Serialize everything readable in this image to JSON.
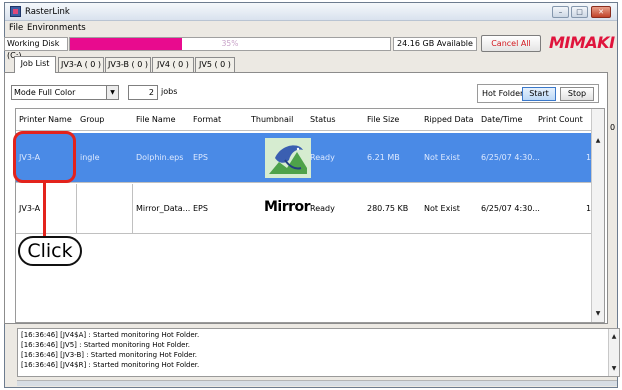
{
  "window": {
    "title": "RasterLink"
  },
  "menu": {
    "items": [
      "File",
      "Environments"
    ]
  },
  "disk": {
    "label": "Working Disk (C:)",
    "progress_percent": 35,
    "progress_text": "35%",
    "available": "24.16 GB Available",
    "cancel_label": "Cancel All"
  },
  "brand": {
    "logo_text": "MIMAKI",
    "color": "#e0143c"
  },
  "tabs": [
    "Job List",
    "JV3-A ( 0 )",
    "JV3-B ( 0 )",
    "JV4 ( 0 )",
    "JV5 ( 0 )"
  ],
  "toolbar": {
    "mode_value": "Mode Full Color",
    "jobs_count": "2",
    "jobs_label": "jobs",
    "hot_folder_label": "Hot Folder",
    "start_label": "Start",
    "stop_label": "Stop"
  },
  "table": {
    "columns": [
      "Printer Name",
      "Group",
      "File Name",
      "Format",
      "Thumbnail",
      "Status",
      "File Size",
      "Ripped Data",
      "Date/Time",
      "Print Count"
    ],
    "rows": [
      {
        "printer": "JV3-A",
        "group": "ingle",
        "file": "Dolphin.eps",
        "format": "EPS",
        "thumbnail": "dolphin-image",
        "status": "Ready",
        "size": "6.21 MB",
        "ripped": "Not Exist",
        "date": "6/25/07 4:30...",
        "count": "1"
      },
      {
        "printer": "JV3-A",
        "group": "",
        "file": "Mirror_Data...",
        "format": "EPS",
        "thumbnail": "Mirror",
        "status": "Ready",
        "size": "280.75 KB",
        "ripped": "Not Exist",
        "date": "6/25/07 4:30...",
        "count": "1"
      }
    ],
    "side_value": "0"
  },
  "annotation": {
    "label": "Click",
    "color": "#e3231c"
  },
  "log": [
    "[16:36:46] [JV4$A] : Started monitoring Hot Folder.",
    "[16:36:46] [JV5] : Started monitoring Hot Folder.",
    "[16:36:46] [JV3-B] : Started monitoring Hot Folder.",
    "[16:36:46] [JV4$R] : Started monitoring Hot Folder."
  ],
  "colors": {
    "selection": "#4a8ae6",
    "progress": "#e80b8e"
  }
}
